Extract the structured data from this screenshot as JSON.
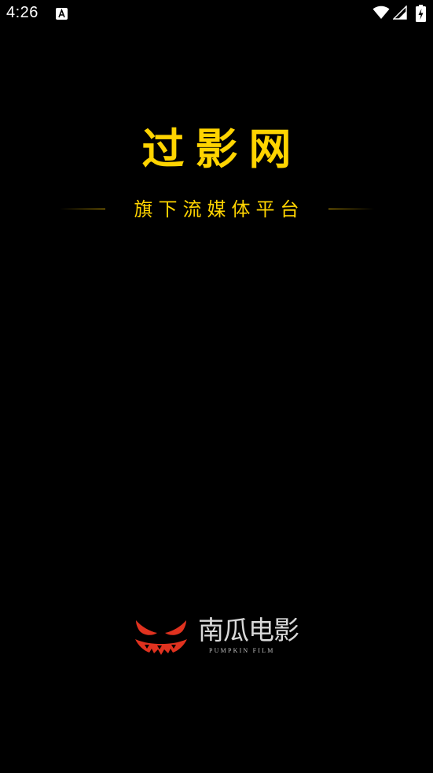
{
  "status_bar": {
    "time": "4:26",
    "notification_icon": "text-a-icon",
    "icons": [
      "wifi-icon",
      "signal-icon",
      "battery-charging-icon"
    ]
  },
  "splash": {
    "title": "过影网",
    "subtitle": "旗下流媒体平台",
    "accent_color": "#ffd400",
    "background_color": "#000000"
  },
  "partner_logo": {
    "name_cn": "南瓜电影",
    "name_en": "PUMPKIN FILM",
    "icon": "pumpkin-face-icon",
    "icon_color": "#e0321f"
  }
}
